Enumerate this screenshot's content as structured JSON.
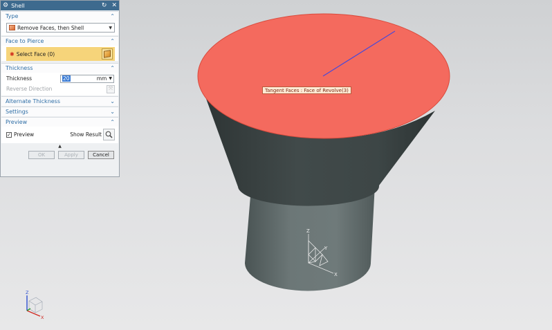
{
  "dialog": {
    "title": "Shell",
    "type_group": {
      "header": "Type",
      "selected": "Remove Faces, then Shell"
    },
    "pierce_group": {
      "header": "Face to Pierce",
      "select_label": "Select Face (0)"
    },
    "thickness_group": {
      "header": "Thickness",
      "label": "Thickness",
      "value": "20",
      "unit": "mm",
      "reverse_label": "Reverse Direction"
    },
    "alternate_group": {
      "header": "Alternate Thickness"
    },
    "settings_group": {
      "header": "Settings"
    },
    "preview_group": {
      "header": "Preview",
      "preview_label": "Preview",
      "show_result_label": "Show Result"
    },
    "buttons": {
      "ok": "OK",
      "apply": "Apply",
      "cancel": "Cancel"
    }
  },
  "viewport": {
    "tooltip": "Tangent Faces : Face of Revolve(3)",
    "wcs_axes": {
      "x": "X",
      "y": "Y",
      "z": "Z"
    },
    "triad_axes": {
      "x": "X",
      "z": "Z"
    }
  },
  "colors": {
    "highlight_face": "#f46a5e",
    "body_dark": "#3f4747",
    "body_light": "#5f6a6a",
    "title_bar": "#3d6a8e"
  }
}
